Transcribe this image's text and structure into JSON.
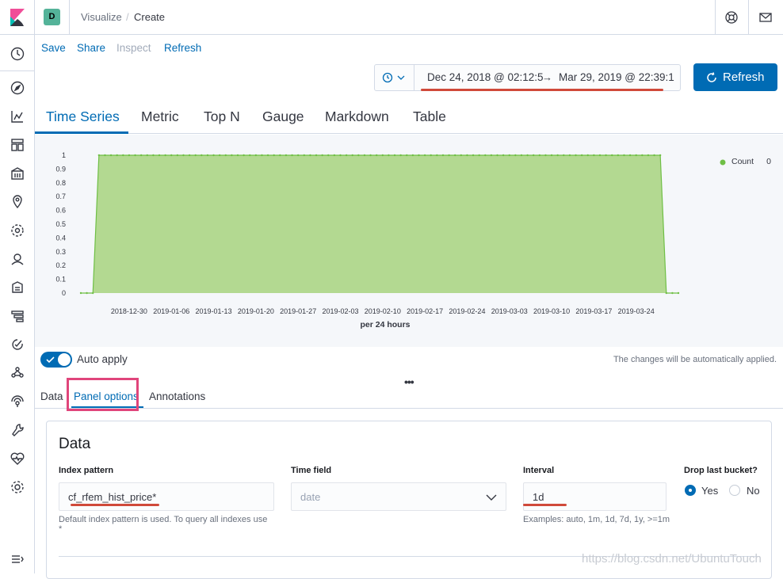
{
  "header": {
    "space_initial": "D",
    "breadcrumbs": [
      "Visualize",
      "Create"
    ],
    "separator": "/"
  },
  "top_nav": {
    "save": "Save",
    "share": "Share",
    "inspect": "Inspect",
    "refresh": "Refresh"
  },
  "query_bar": {
    "start": "Dec 24, 2018 @ 02:12:5",
    "arrow": "→",
    "end": "Mar 29, 2019 @ 22:39:1",
    "refresh_button": "Refresh"
  },
  "viz_tabs": [
    "Time Series",
    "Metric",
    "Top N",
    "Gauge",
    "Markdown",
    "Table"
  ],
  "chart_data": {
    "type": "area",
    "x": [
      "2018-12-24",
      "2018-12-25",
      "2019-03-28",
      "2019-03-29"
    ],
    "series": [
      {
        "name": "Count",
        "values": [
          0,
          1,
          1,
          0
        ],
        "color": "#a7d37e"
      }
    ],
    "x_tick_labels": [
      "2018-12-30",
      "2019-01-06",
      "2019-01-13",
      "2019-01-20",
      "2019-01-27",
      "2019-02-03",
      "2019-02-10",
      "2019-02-17",
      "2019-02-24",
      "2019-03-03",
      "2019-03-10",
      "2019-03-17",
      "2019-03-24"
    ],
    "y_tick_labels": [
      "0",
      "0.1",
      "0.2",
      "0.3",
      "0.4",
      "0.5",
      "0.6",
      "0.7",
      "0.8",
      "0.9",
      "1"
    ],
    "ylim": [
      0,
      1
    ],
    "xlabel": "per 24 hours",
    "legend": {
      "label": "Count",
      "value": "0",
      "placement": "top-right"
    }
  },
  "auto_apply": {
    "label": "Auto apply",
    "note": "The changes will be automatically applied.",
    "enabled": true
  },
  "sub_tabs": [
    "Data",
    "Panel options",
    "Annotations"
  ],
  "panel": {
    "title": "Data",
    "index_pattern": {
      "label": "Index pattern",
      "value": "cf_rfem_hist_price*",
      "help": "Default index pattern is used. To query all indexes use",
      "help2": "*"
    },
    "time_field": {
      "label": "Time field",
      "placeholder": "date"
    },
    "interval": {
      "label": "Interval",
      "value": "1d",
      "help": "Examples: auto, 1m, 1d, 7d, 1y, >=1m"
    },
    "drop_last": {
      "label": "Drop last bucket?",
      "yes": "Yes",
      "no": "No",
      "selected": "Yes"
    }
  },
  "watermark": "https://blog.csdn.net/UbuntuTouch",
  "colors": {
    "accent": "#006bb4",
    "area": "#a7d37e",
    "highlight": "#e0457b",
    "annotation": "#d04a3a"
  }
}
